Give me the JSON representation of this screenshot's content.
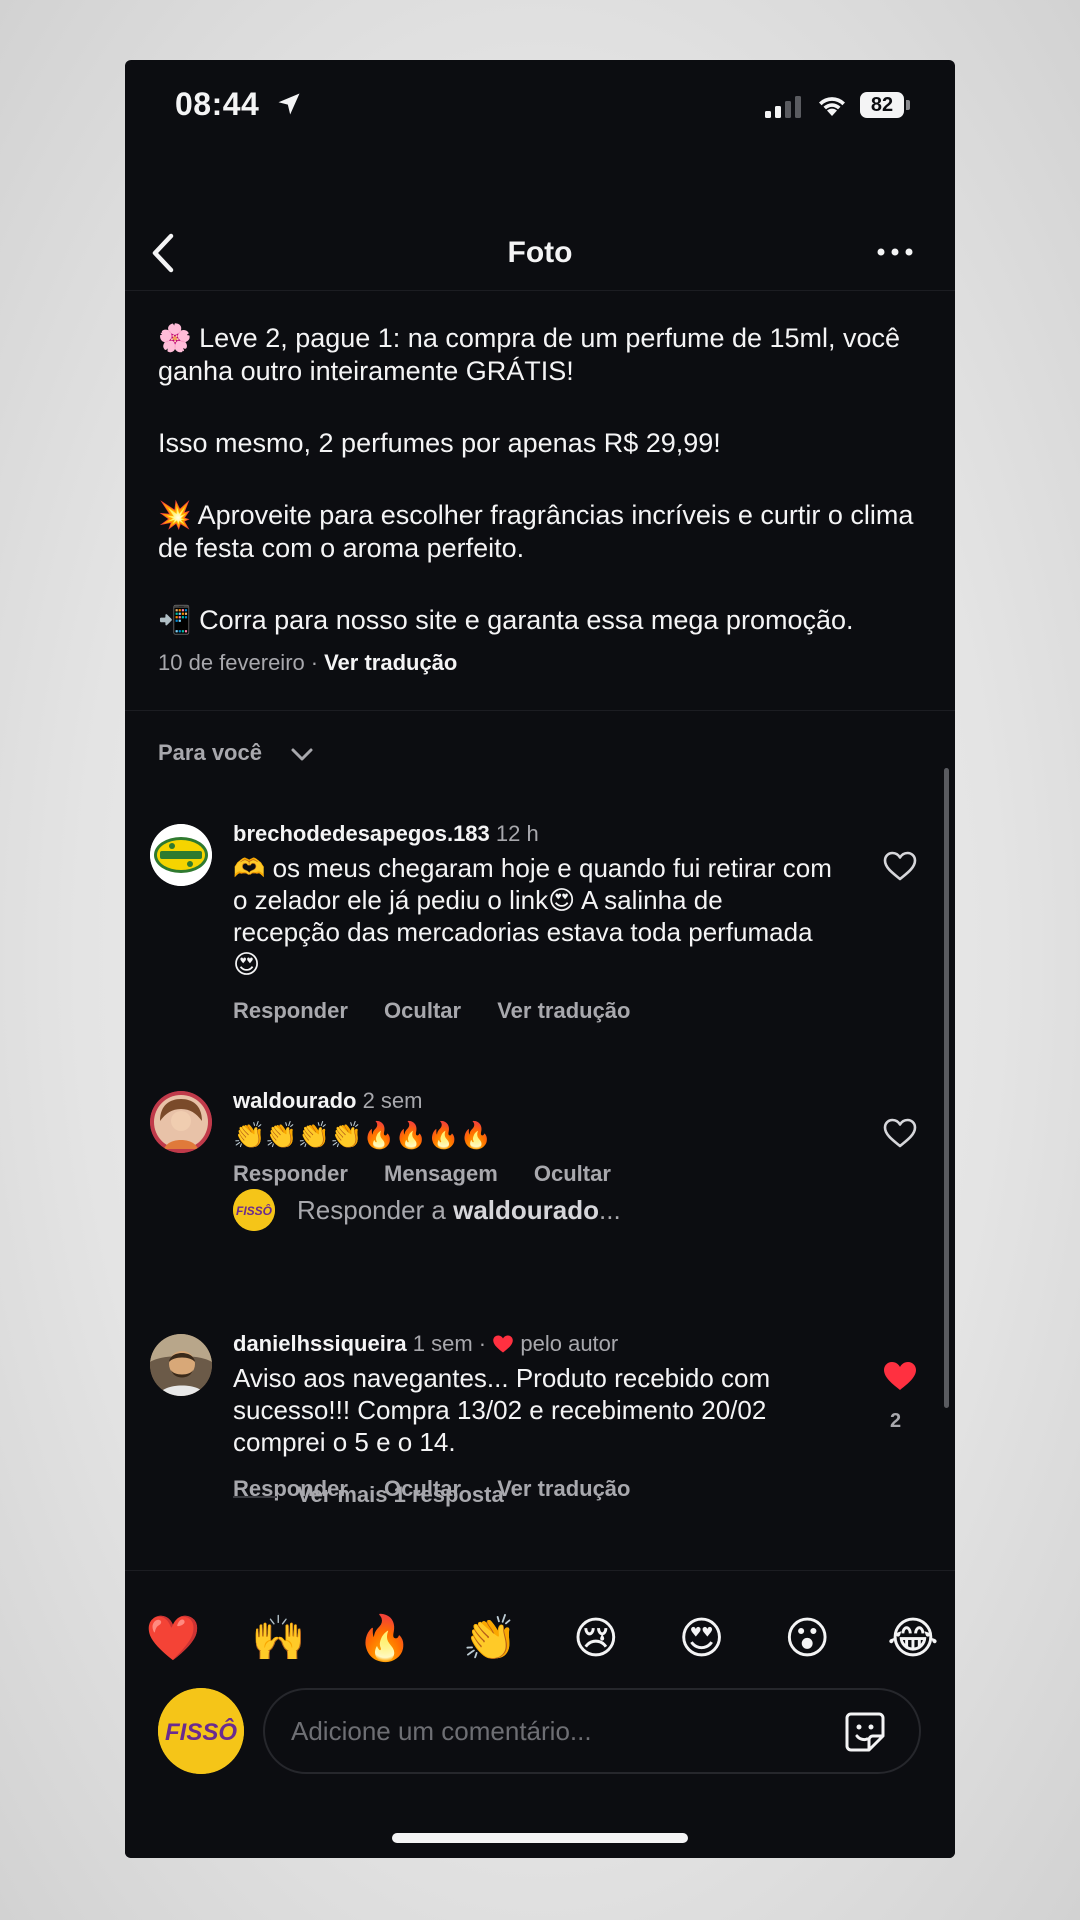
{
  "status_bar": {
    "time": "08:44",
    "battery": "82"
  },
  "header": {
    "title": "Foto"
  },
  "caption": {
    "lines": [
      "Leve 2, pague 1: na compra de um perfume de 15ml, você ganha outro inteiramente GRÁTIS!",
      "Isso mesmo, 2 perfumes por apenas R$ 29,99!",
      "Aproveite para escolher fragrâncias incríveis e curtir o clima de festa com o aroma perfeito.",
      "Corra para nosso site e garanta essa mega promoção."
    ],
    "emojis": [
      "🌸",
      "💥",
      "📲"
    ],
    "date": "10 de fevereiro",
    "translate_label": "Ver tradução"
  },
  "section": {
    "label": "Para você"
  },
  "comments": [
    {
      "username": "brechodedesapegos.183",
      "time": "12 h",
      "text": "🫶 os meus chegaram hoje e quando fui retirar com o zelador ele já pediu o link😍  A salinha de recepção das mercadorias estava toda perfumada😍",
      "actions": [
        "Responder",
        "Ocultar",
        "Ver tradução"
      ]
    },
    {
      "username": "waldourado",
      "time": "2 sem",
      "text": "👏👏👏👏🔥🔥🔥🔥",
      "actions": [
        "Responder",
        "Mensagem",
        "Ocultar"
      ]
    },
    {
      "username": "danielhssiqueira",
      "time": "1 sem",
      "author_like": "pelo autor",
      "text": "Aviso aos navegantes... Produto recebido com sucesso!!! Compra 13/02 e recebimento 20/02 comprei o 5 e o 14.",
      "actions": [
        "Responder",
        "Ocultar",
        "Ver tradução"
      ],
      "like_count": "2"
    }
  ],
  "reply_to": {
    "prefix": "Responder a",
    "username": "waldourado",
    "suffix": "..."
  },
  "more_replies": "Ver mais 1 resposta",
  "reactions": [
    "❤️",
    "🙌",
    "🔥",
    "👏",
    "😢",
    "😍",
    "😮",
    "😂"
  ],
  "composer": {
    "placeholder": "Adicione um comentário...",
    "avatar_text": "FISSÔ"
  },
  "colors": {
    "background": "#0c0d11",
    "text": "#f4f4f5",
    "muted": "#a8a8ad",
    "like_red": "#ff3040",
    "brand_yellow": "#f5c518",
    "brand_purple": "#6a2b8f"
  }
}
